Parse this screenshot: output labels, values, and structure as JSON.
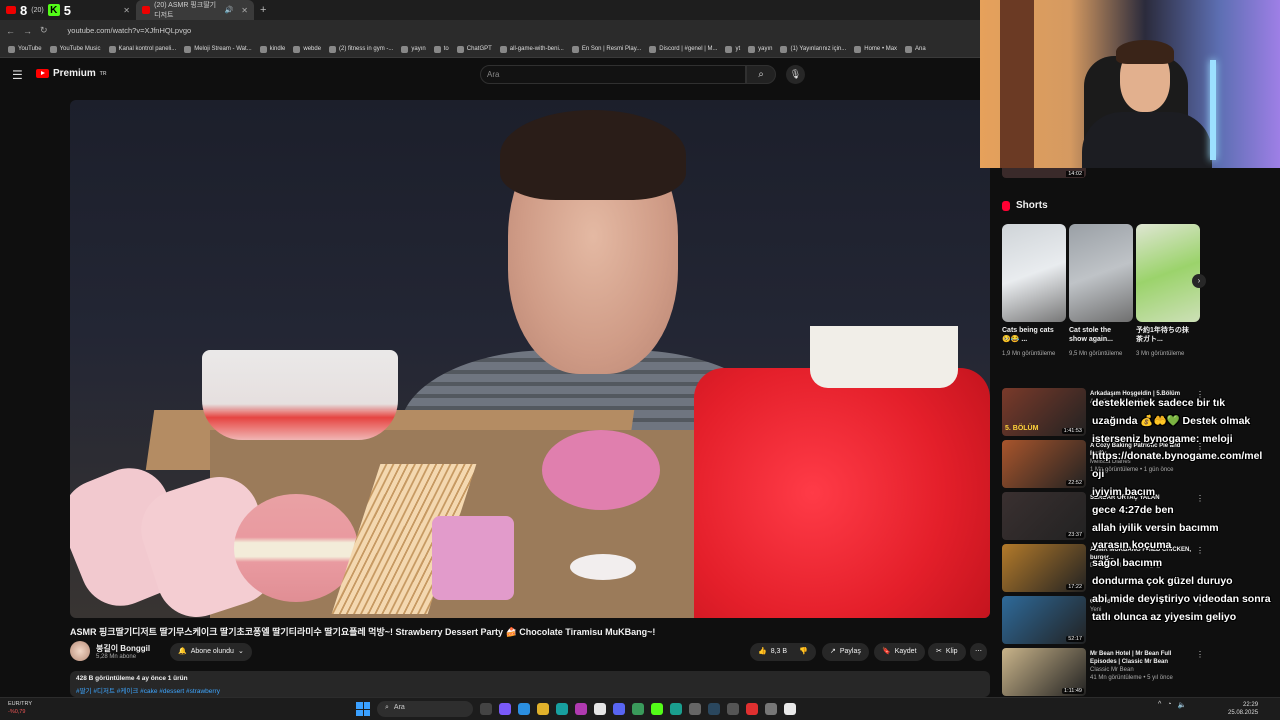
{
  "browser": {
    "tab_active_label": "(20) ASMR 핑크딸기디저트",
    "tab_first_count": "(20)",
    "overlay_score_left": "8",
    "overlay_score_right": "5",
    "url": "youtube.com/watch?v=XJfnHQLpvgo",
    "bookmarks": [
      "YouTube",
      "YouTube Music",
      "Kanal kontrol paneli...",
      "Meloji Stream - Wat...",
      "kindle",
      "webde",
      "(2) fitness in gym -...",
      "yayın",
      "to",
      "ChatGPT",
      "all-game-with-beni...",
      "En Son | Resmi Play...",
      "Discord | #genel | M...",
      "yt",
      "yayın",
      "(1) Yayınlarınız için...",
      "Home • Max",
      "Ana"
    ]
  },
  "youtube": {
    "logo_label": "Premium",
    "logo_region": "TR",
    "search_placeholder": "Ara",
    "video_title": "ASMR 핑크딸기디저트 딸기무스케이크 딸기초코퐁엘 딸기티라미수 딸기요플레 먹방~! Strawberry Dessert Party 🍰 Chocolate Tiramisu MuKBang~!",
    "channel_name": "붕길이 Bonggil",
    "subscribers": "5,28 Mn abone",
    "subscribe_label": "Abone olundu",
    "likes": "8,3 B",
    "share_label": "Paylaş",
    "save_label": "Kaydet",
    "clip_label": "Klip",
    "desc_line1": "428 B görüntüleme  4 ay önce  1 ürün",
    "desc_tags": "#딸기 #디저트 #케이크 #cake #dessert #strawberry"
  },
  "sidebar": {
    "top_duration": "14:02",
    "shorts_heading": "Shorts",
    "shorts": [
      {
        "title": "Cats being cats 🥺😂 ...",
        "views": "1,9 Mn görüntüleme"
      },
      {
        "title": "Cat stole the show again...",
        "views": "9,5 Mn görüntüleme"
      },
      {
        "title": "予約1年待ちの抹茶ガト...",
        "views": "3 Mn görüntüleme"
      }
    ],
    "videos": [
      {
        "title": "Arkadaşım Hoşgeldin | 5.Bölüm",
        "channel": "Arkadaşım Hoşgeldin",
        "meta": "",
        "duration": "1:41:53",
        "thumb": "5. BÖLÜM"
      },
      {
        "title": "A Cozy Baking Patriotic Pie and Fluffy...",
        "channel": "Melissa Diaries",
        "meta": "1 Mn görüntüleme • 1 gün önce",
        "duration": "22:52",
        "thumb": ""
      },
      {
        "title": "SERDAR ORTAÇ YALAN",
        "channel": "",
        "meta": "",
        "duration": "23:37",
        "thumb": ""
      },
      {
        "title": "ASMR MUKBANG FRIED CHICKEN, burger...",
        "channel": "DONGSAM TABLE 야생 밥",
        "meta": "",
        "duration": "17:22",
        "thumb": ""
      },
      {
        "title": "Cursed Video...",
        "channel": "",
        "meta": "Yeni",
        "duration": "52:17",
        "thumb": ""
      },
      {
        "title": "Mr Bean Hotel | Mr Bean Full Episodes | Classic Mr Bean",
        "channel": "Classic Mr Bean",
        "meta": "41 Mn görüntüleme • 5 yıl önce",
        "duration": "1:11:49",
        "thumb": ""
      }
    ]
  },
  "chat": [
    "desteklemek sadece bir tık",
    "uzağında 💰🤲💚 Destek olmak",
    "isterseniz bynogame: meloji",
    "https://donate.bynogame.com/mel",
    "oji",
    "iyiyim bacım",
    "gece 4:27de ben",
    "allah iyilik versin bacımm",
    "yarasın koçuma",
    "sağol bacımm",
    "dondurma çok güzel duruyo",
    "abi mide deyiştiriyo videodan sonra",
    "tatlı olunca az yiyesim geliyo"
  ],
  "taskbar": {
    "ticker_label": "EUR/TRY",
    "ticker_value": "-%0,79",
    "search_placeholder": "Ara",
    "time": "22:29",
    "date": "25.08.2025"
  }
}
